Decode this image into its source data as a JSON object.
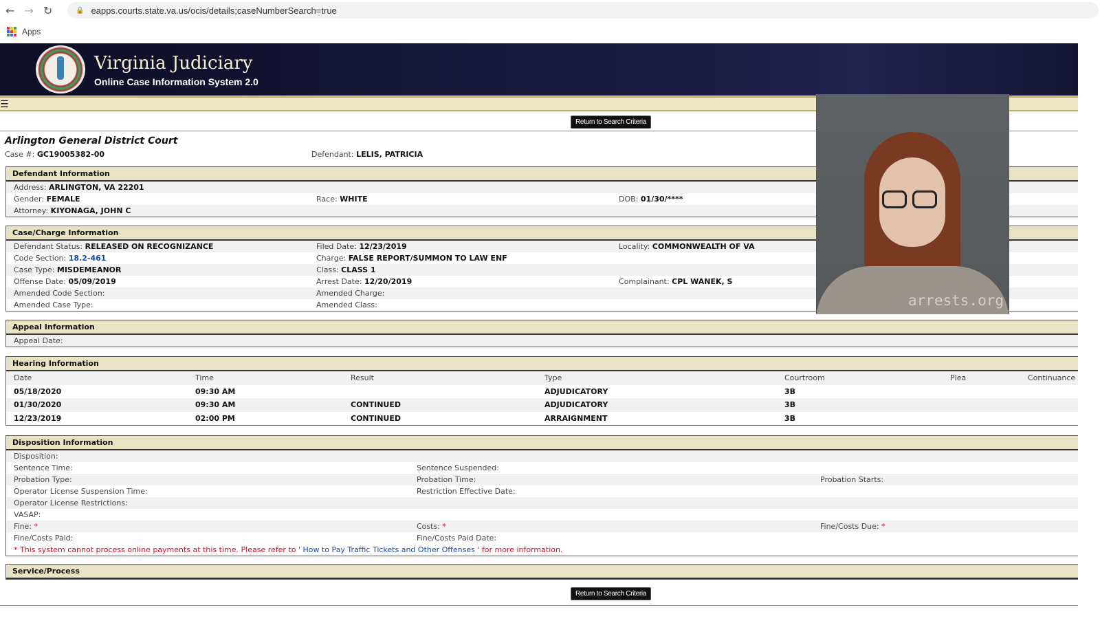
{
  "browser": {
    "url": "eapps.courts.state.va.us/ocis/details;caseNumberSearch=true",
    "bookmarks_label": "Apps"
  },
  "header": {
    "title": "Virginia Judiciary",
    "subtitle": "Online Case Information System 2.0"
  },
  "return_button": "Return to Search Criteria",
  "court": "Arlington General District Court",
  "case": {
    "case_label": "Case #:",
    "case_number": "GC19005382-00",
    "defendant_label": "Defendant:",
    "defendant": "LELIS, PATRICIA"
  },
  "defendant_info": {
    "title": "Defendant Information",
    "rows": [
      [
        {
          "l": "Address:",
          "v": "ARLINGTON, VA 22201"
        }
      ],
      [
        {
          "l": "Gender:",
          "v": "FEMALE"
        },
        {
          "l": "Race:",
          "v": "WHITE"
        },
        {
          "l": "DOB:",
          "v": "01/30/****"
        }
      ],
      [
        {
          "l": "Attorney:",
          "v": "KIYONAGA, JOHN C"
        }
      ]
    ]
  },
  "case_charge": {
    "title": "Case/Charge Information",
    "rows": [
      [
        {
          "l": "Defendant Status:",
          "v": "RELEASED ON RECOGNIZANCE"
        },
        {
          "l": "Filed Date:",
          "v": "12/23/2019"
        },
        {
          "l": "Locality:",
          "v": "COMMONWEALTH OF VA"
        }
      ],
      [
        {
          "l": "Code Section:",
          "v": "18.2-461",
          "link": true
        },
        {
          "l": "Charge:",
          "v": "FALSE REPORT/SUMMON TO LAW ENF"
        }
      ],
      [
        {
          "l": "Case Type:",
          "v": "MISDEMEANOR"
        },
        {
          "l": "Class:",
          "v": "CLASS 1"
        }
      ],
      [
        {
          "l": "Offense Date:",
          "v": "05/09/2019"
        },
        {
          "l": "Arrest Date:",
          "v": "12/20/2019"
        },
        {
          "l": "Complainant:",
          "v": "CPL WANEK, S"
        }
      ],
      [
        {
          "l": "Amended Code Section:",
          "v": ""
        },
        {
          "l": "Amended Charge:",
          "v": ""
        }
      ],
      [
        {
          "l": "Amended Case Type:",
          "v": ""
        },
        {
          "l": "Amended Class:",
          "v": ""
        }
      ]
    ]
  },
  "appeal": {
    "title": "Appeal Information",
    "rows": [
      [
        {
          "l": "Appeal Date:",
          "v": ""
        }
      ]
    ]
  },
  "hearing": {
    "title": "Hearing Information",
    "columns": [
      "Date",
      "Time",
      "Result",
      "Type",
      "Courtroom",
      "Plea",
      "Continuance"
    ],
    "rows": [
      [
        "05/18/2020",
        "09:30 AM",
        "",
        "ADJUDICATORY",
        "3B",
        "",
        ""
      ],
      [
        "01/30/2020",
        "09:30 AM",
        "CONTINUED",
        "ADJUDICATORY",
        "3B",
        "",
        ""
      ],
      [
        "12/23/2019",
        "02:00 PM",
        "CONTINUED",
        "ARRAIGNMENT",
        "3B",
        "",
        ""
      ]
    ]
  },
  "disposition": {
    "title": "Disposition Information",
    "rows": [
      [
        {
          "l": "Disposition:",
          "v": ""
        }
      ],
      [
        {
          "l": "Sentence Time:",
          "v": ""
        },
        {
          "l": "Sentence Suspended:",
          "v": ""
        }
      ],
      [
        {
          "l": "Probation Type:",
          "v": ""
        },
        {
          "l": "Probation Time:",
          "v": ""
        },
        {
          "l": "Probation Starts:",
          "v": ""
        }
      ],
      [
        {
          "l": "Operator License Suspension Time:",
          "v": ""
        },
        {
          "l": "Restriction Effective Date:",
          "v": ""
        }
      ],
      [
        {
          "l": "Operator License Restrictions:",
          "v": ""
        }
      ],
      [
        {
          "l": "VASAP:",
          "v": ""
        }
      ],
      [
        {
          "l": "Fine:",
          "v": "",
          "star": true
        },
        {
          "l": "Costs:",
          "v": "",
          "star": true
        },
        {
          "l": "Fine/Costs Due:",
          "v": "",
          "star": true
        }
      ],
      [
        {
          "l": "Fine/Costs Paid:",
          "v": ""
        },
        {
          "l": "Fine/Costs Paid Date:",
          "v": ""
        }
      ]
    ],
    "note_pre": "* This system cannot process online payments at this time. Please refer to '",
    "note_link": " How to Pay Traffic Tickets and Other Offenses ",
    "note_post": "' for more information."
  },
  "service": {
    "title": "Service/Process"
  },
  "photo": {
    "watermark": "arrests.org"
  },
  "colors": {
    "header_bg": "#141432",
    "section_header": "#e8e3c2",
    "link": "#1a4aa8",
    "required": "#d0102a"
  }
}
